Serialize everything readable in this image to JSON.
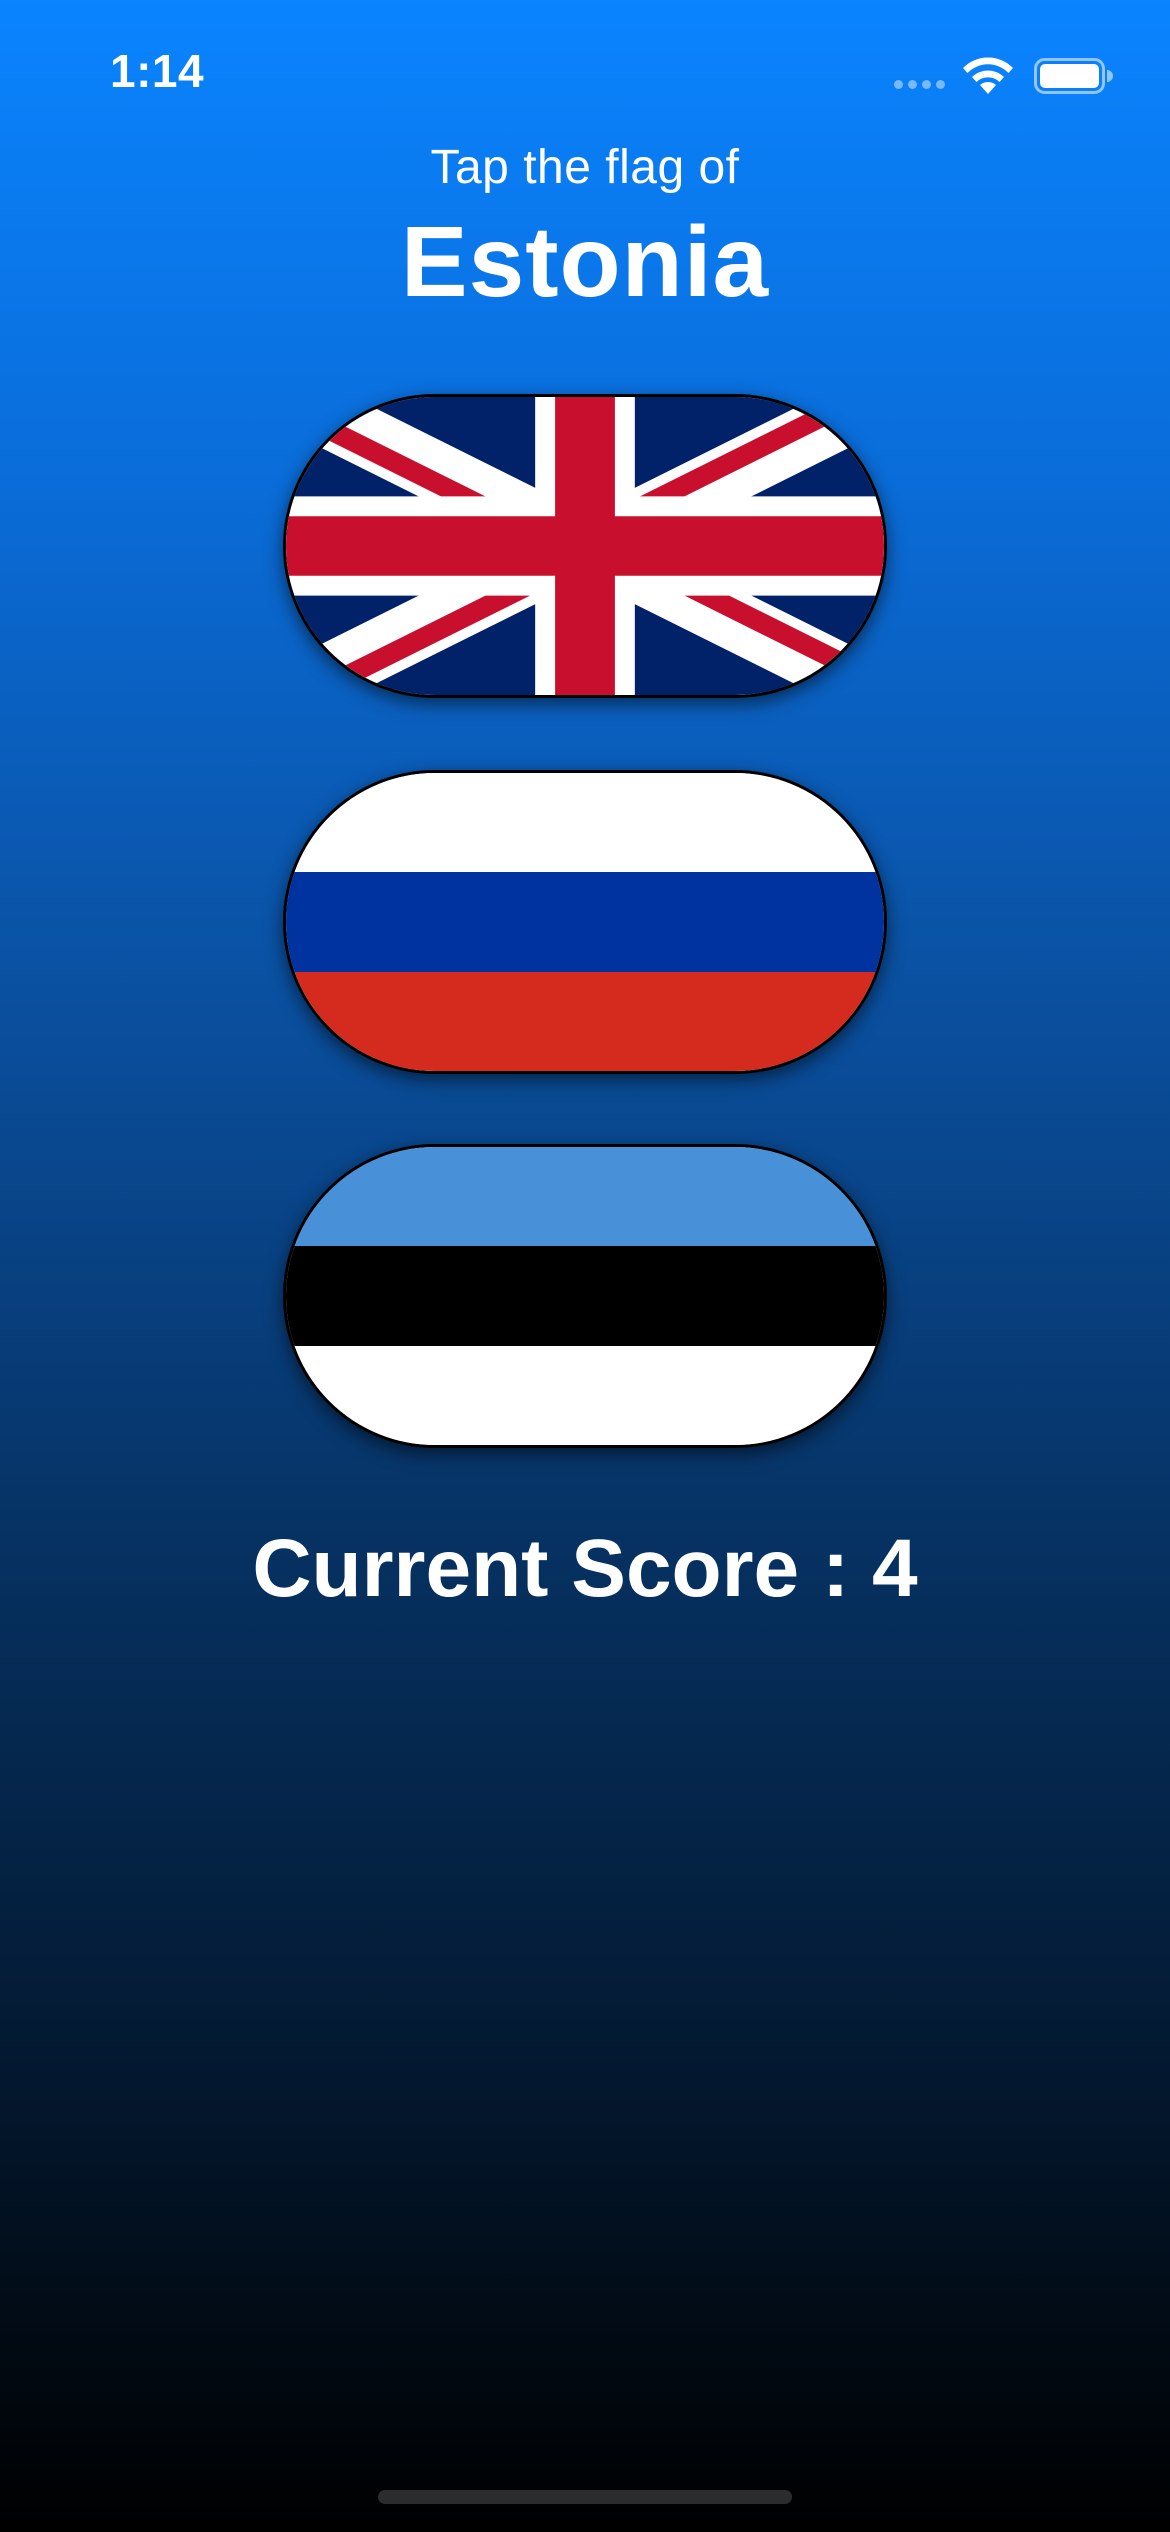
{
  "status_bar": {
    "time": "1:14",
    "icons": [
      "cellular-signal-icon",
      "wifi-icon",
      "battery-icon"
    ]
  },
  "header": {
    "prompt": "Tap the flag of",
    "country": "Estonia"
  },
  "flags": [
    {
      "name": "UK",
      "icon": "uk-flag-icon"
    },
    {
      "name": "Russia",
      "icon": "russia-flag-icon",
      "stripes": [
        "#ffffff",
        "#0033a0",
        "#d52b1e"
      ]
    },
    {
      "name": "Estonia",
      "icon": "estonia-flag-icon",
      "stripes": [
        "#4891d9",
        "#000000",
        "#ffffff"
      ]
    }
  ],
  "score": {
    "label": "Current Score : 4"
  },
  "colors": {
    "gradient_top": "#0a84ff",
    "gradient_bottom": "#000000",
    "text": "#ffffff"
  }
}
